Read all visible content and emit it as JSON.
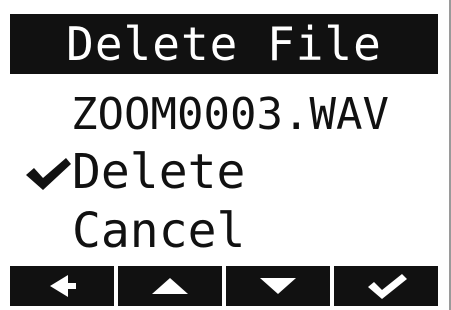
{
  "screen": {
    "title": "Delete File",
    "file_name": "ZOOM0003.WAV",
    "menu": [
      {
        "label": "Delete",
        "selected": true
      },
      {
        "label": "Cancel",
        "selected": false
      }
    ]
  },
  "soft_keys": [
    {
      "icon": "arrow-left-icon"
    },
    {
      "icon": "arrow-up-icon"
    },
    {
      "icon": "arrow-down-icon"
    },
    {
      "icon": "check-icon"
    }
  ],
  "colors": {
    "background": "#ffffff",
    "foreground": "#111111",
    "inverse_text": "#ffffff"
  }
}
